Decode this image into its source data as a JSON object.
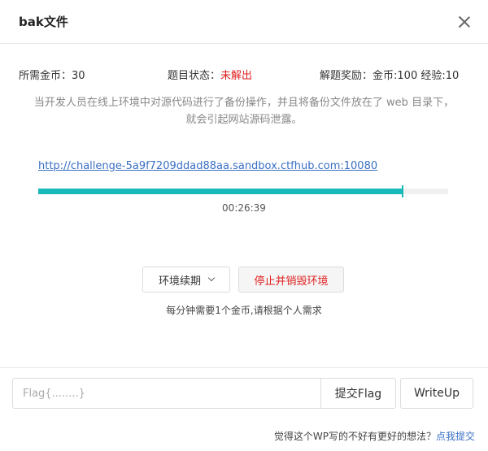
{
  "modal": {
    "title": "bak文件"
  },
  "info": {
    "cost_label": "所需金币：",
    "cost_value": "30",
    "status_label": "题目状态：",
    "status_value": "未解出",
    "reward_label": "解题奖励：",
    "reward_value": "金币:100 经验:10"
  },
  "description": {
    "line1": "当开发人员在线上环境中对源代码进行了备份操作，并且将备份文件放在了 web 目录下，",
    "line2": "就会引起网站源码泄露。"
  },
  "environment": {
    "url": "http://challenge-5a9f7209ddad88aa.sandbox.ctfhub.com:10080",
    "progress_fraction": 0.888,
    "timer": "00:26:39"
  },
  "actions": {
    "renew_label": "环境续期",
    "stop_label": "停止并销毁环境",
    "note": "每分钟需要1个金币,请根据个人需求"
  },
  "flag": {
    "placeholder": "Flag{........}",
    "value": "",
    "submit_label": "提交Flag",
    "writeup_label": "WriteUp"
  },
  "feedback": {
    "text": "觉得这个WP写的不好有更好的想法？",
    "link": "点我提交"
  },
  "colors": {
    "accent": "#18b9b9",
    "danger": "#e02020",
    "link": "#3a6fc4"
  }
}
